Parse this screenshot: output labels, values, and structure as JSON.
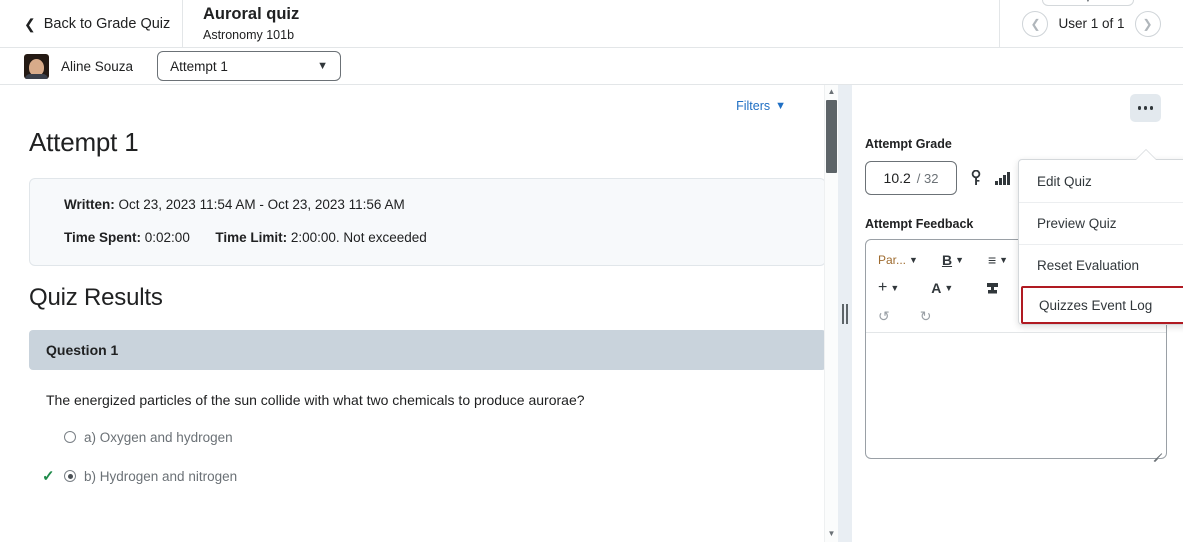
{
  "topbar": {
    "back_label": "Back to Grade Quiz",
    "back_icon": "chevron-left-icon",
    "quiz_title": "Auroral quiz",
    "quiz_subtitle": "Astronomy 101b",
    "prev_icon": "chevron-left-circle-icon",
    "next_icon": "chevron-right-circle-icon",
    "user_count": "User 1 of 1",
    "cut_dropdown_icon": "chevron-down-icon"
  },
  "subbar": {
    "student_name": "Aline Souza",
    "attempt_value": "Attempt 1",
    "attempt_chevron": "chevron-down-icon"
  },
  "left": {
    "filters_label": "Filters",
    "filters_chevron": "chevron-down-icon",
    "attempt_heading": "Attempt 1",
    "info": {
      "written_label": "Written:",
      "written_value": "Oct 23, 2023 11:54 AM - Oct 23, 2023 11:56 AM",
      "time_spent_label": "Time Spent:",
      "time_spent_value": "0:02:00",
      "time_limit_label": "Time Limit:",
      "time_limit_value": "2:00:00. Not exceeded"
    },
    "results_heading": "Quiz Results",
    "question": {
      "header": "Question 1",
      "text": "The energized particles of the sun collide with what two chemicals to produce aurorae?",
      "options": [
        {
          "label": "a) Oxygen and hydrogen",
          "selected": false,
          "correct": false
        },
        {
          "label": "b) Hydrogen and nitrogen",
          "selected": true,
          "correct": true
        }
      ],
      "correct_icon": "check-icon"
    }
  },
  "right": {
    "kebab_icon": "more-options-icon",
    "attempt_grade_label": "Attempt Grade",
    "grade_score": "10.2",
    "grade_out_of": "/ 32",
    "key_icon": "key-icon",
    "stats_icon": "bar-chart-icon",
    "attempt_feedback_label": "Attempt Feedback",
    "editor_toolbar": [
      {
        "name": "paragraph-format-dropdown",
        "label": "Par...",
        "chevron": "chevron-down-icon"
      },
      {
        "name": "bold-button",
        "label": "B",
        "chevron": "chevron-down-icon"
      },
      {
        "name": "align-dropdown",
        "label": "≡",
        "chevron": "chevron-down-icon"
      },
      {
        "name": "insert-dropdown",
        "label": "+",
        "chevron": "chevron-down-icon"
      },
      {
        "name": "font-style-dropdown",
        "label": "A",
        "chevron": "chevron-down-icon"
      },
      {
        "name": "format-painter-button",
        "label": "⬛",
        "chevron": ""
      },
      {
        "name": "undo-button",
        "label": "↺",
        "chevron": ""
      },
      {
        "name": "redo-button",
        "label": "↻",
        "chevron": ""
      }
    ],
    "editor_content": "",
    "resize_icon": "resize-handle-icon"
  },
  "menu": {
    "items": [
      {
        "label": "Edit Quiz",
        "highlighted": false
      },
      {
        "label": "Preview Quiz",
        "highlighted": false
      },
      {
        "label": "Reset Evaluation",
        "highlighted": false
      },
      {
        "label": "Quizzes Event Log",
        "highlighted": true
      }
    ],
    "highlight_color": "#b01a22"
  },
  "scrollbar": {
    "up_icon": "triangle-up-icon",
    "down_icon": "triangle-down-icon"
  },
  "splitter": {
    "grip_icon": "drag-handle-icon"
  }
}
